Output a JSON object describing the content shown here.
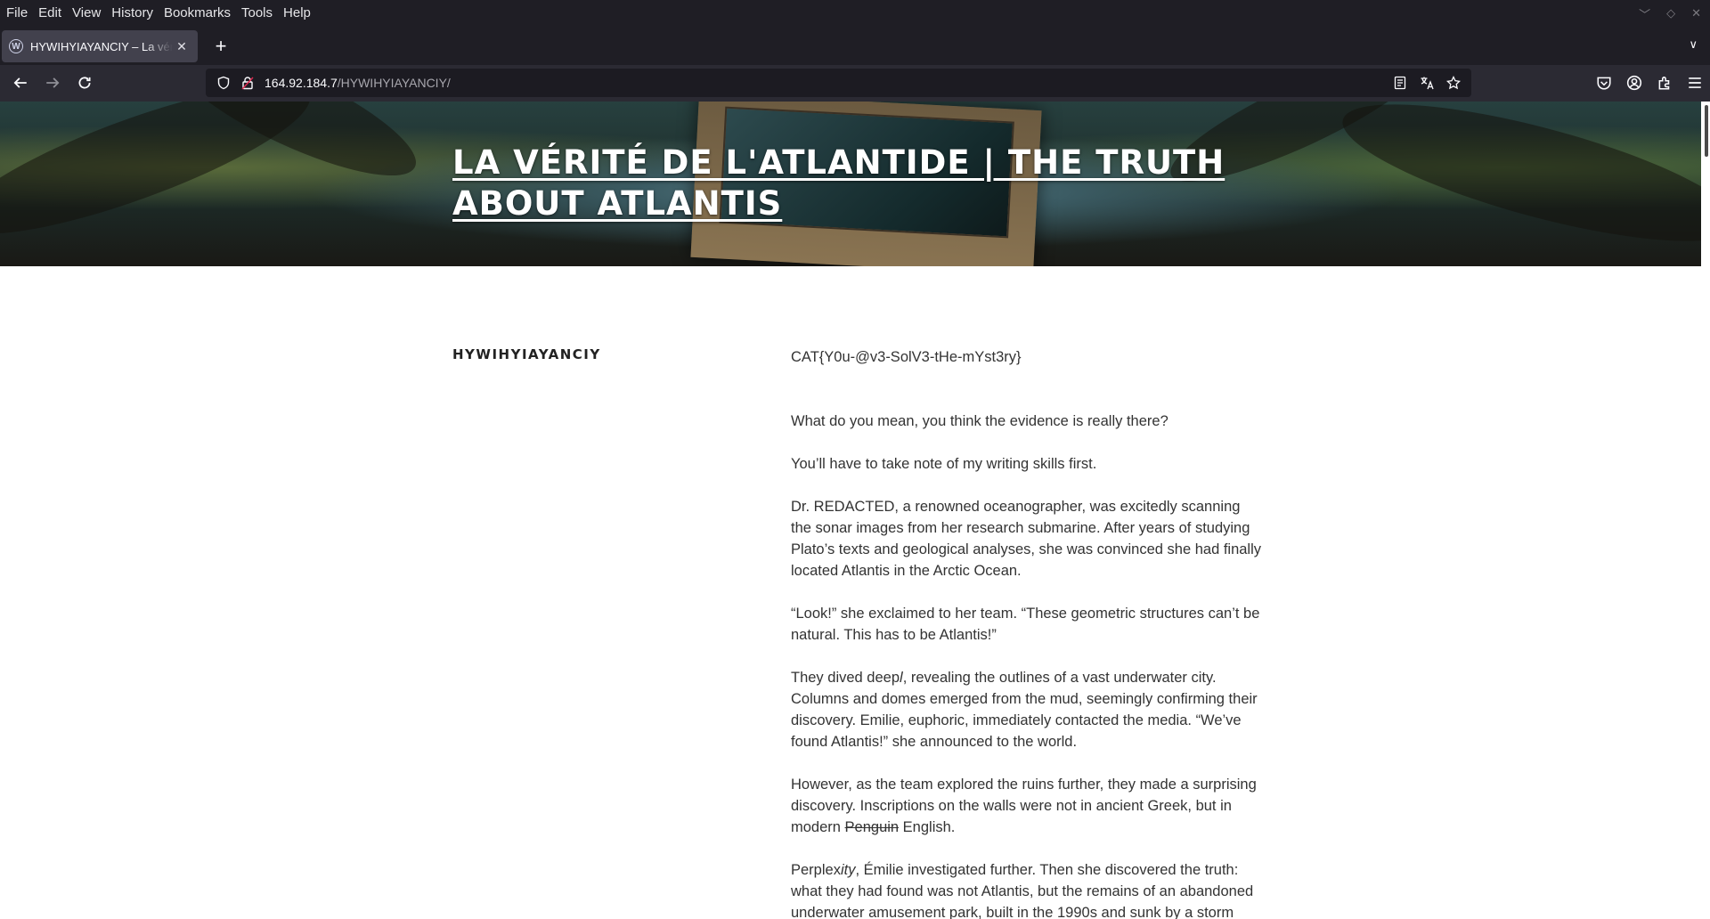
{
  "menubar": {
    "items": [
      "File",
      "Edit",
      "View",
      "History",
      "Bookmarks",
      "Tools",
      "Help"
    ]
  },
  "tab": {
    "title": "HYWIHYIAYANCIY – La vérité de l'Atlantide",
    "favicon": "wordpress-icon"
  },
  "navbar": {
    "url_host": "164.92.184.7",
    "url_path": "/HYWIHYIAYANCIY/"
  },
  "site": {
    "title": "LA VÉRITÉ DE L'ATLANTIDE | THE TRUTH ABOUT ATLANTIS"
  },
  "post": {
    "title": "HYWIHYIAYANCIY",
    "flag": "CAT{Y0u-@v3-SolV3-tHe-mYst3ry}",
    "p1": "What do you mean, you think the evidence is really there?",
    "p2": "You’ll have to take note of my writing skills first.",
    "p3": "Dr. REDACTED, a renowned oceanographer, was excitedly scanning the sonar images from her research submarine. After years of studying Plato’s texts and geological analyses, she was convinced she had finally located Atlantis in the Arctic Ocean.",
    "p4": "“Look!” she exclaimed to her team. “These geometric structures can’t be natural. This has to be Atlantis!”",
    "p5_a": "They dived deep",
    "p5_b": "l",
    "p5_c": ", revealing the outlines of a vast underwater city. Columns and domes emerged from the mud, seemingly confirming their discovery. Emilie, euphoric, immediately contacted the media. “We’ve found Atlantis!” she announced to the world.",
    "p6_a": "However, as the team explored the ruins further, they made a surprising discovery. Inscriptions on the walls were not in ancient Greek, but in modern ",
    "p6_strike": "Penguin",
    "p6_b": " English.",
    "p7_a": "Perplex",
    "p7_b": "ity",
    "p7_c": ", Émilie investigated further. Then she discovered the truth: what they had found was not Atlantis, but the remains of an abandoned underwater amusement park, built in the 1990s and sunk by a storm"
  }
}
